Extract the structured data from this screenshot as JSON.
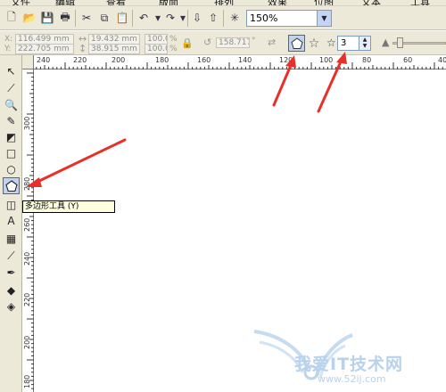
{
  "menu": {
    "items": [
      "文件",
      "编辑",
      "查看",
      "版面",
      "排列",
      "效果",
      "位图",
      "文本",
      "工具"
    ]
  },
  "toolbar": {
    "zoom_value": "150%"
  },
  "property_bar": {
    "x_label": "X:",
    "x_value": "116.499 mm",
    "y_label": "Y:",
    "y_value": "222.705 mm",
    "width_value": "19.432 mm",
    "height_value": "38.915 mm",
    "scale_x": "100.0",
    "scale_y": "100.0",
    "scale_unit": "%",
    "angle_value": "158.717",
    "angle_unit": "°",
    "points_value": "3"
  },
  "rulers": {
    "top_ticks": [
      "240",
      "220",
      "200",
      "180",
      "160",
      "140",
      "120",
      "100",
      "80",
      "60",
      "40"
    ],
    "left_ticks": [
      "300",
      "280",
      "260",
      "240",
      "220",
      "200",
      "180"
    ]
  },
  "tooltip": {
    "text": "多边形工具 (Y)"
  },
  "watermark": {
    "title": "我爱IT技术网",
    "url": "www.52ij.com"
  },
  "colors": {
    "annotation_arrow": "#e8302a",
    "toolbar_bg": "#ece9d8",
    "selected_bg": "#c1d2ee",
    "selected_border": "#316ac5",
    "watermark": "#b9d2ec"
  }
}
